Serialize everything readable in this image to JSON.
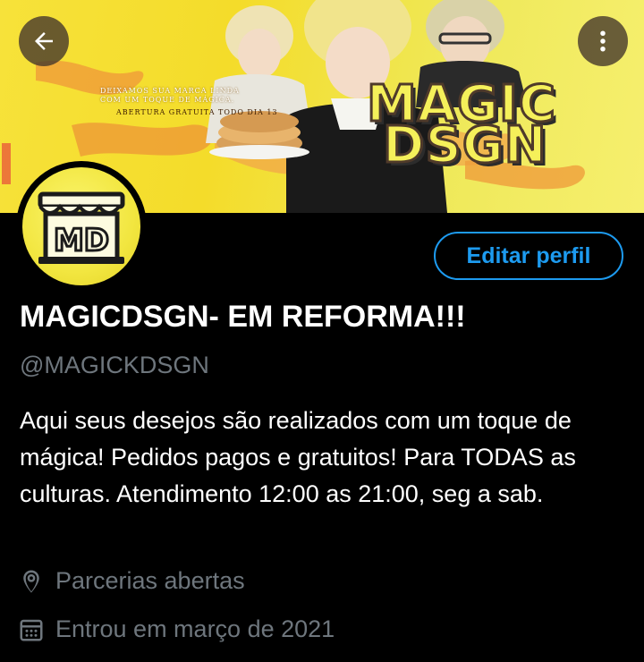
{
  "header": {
    "back_icon": "arrow-left-icon",
    "more_icon": "more-vertical-icon"
  },
  "banner": {
    "line1": "DEIXAMOS SUA MARCA LINDA",
    "line2": "COM UM TOQUE DE MÁGICA.",
    "line3": "ABERTURA GRATUITA TODO DIA 13",
    "logo_line1": "MAGIC",
    "logo_line2": "DSGN"
  },
  "avatar": {
    "text": "MD"
  },
  "profile": {
    "edit_label": "Editar perfil",
    "display_name": "MAGICDSGN- EM REFORMA!!!",
    "handle": "@MAGICKDSGN",
    "bio": "Aqui seus desejos são realizados com um toque de mágica! Pedidos pagos e gratuitos! Para TODAS as culturas. Atendimento 12:00 as 21:00, seg a sab.",
    "location": "Parcerias abertas",
    "location_icon": "location-pin-icon",
    "joined": "Entrou em março de 2021",
    "joined_icon": "calendar-icon"
  },
  "colors": {
    "accent": "#1d9bf0",
    "muted": "#6e767d",
    "banner_yellow": "#f4dc2a"
  }
}
